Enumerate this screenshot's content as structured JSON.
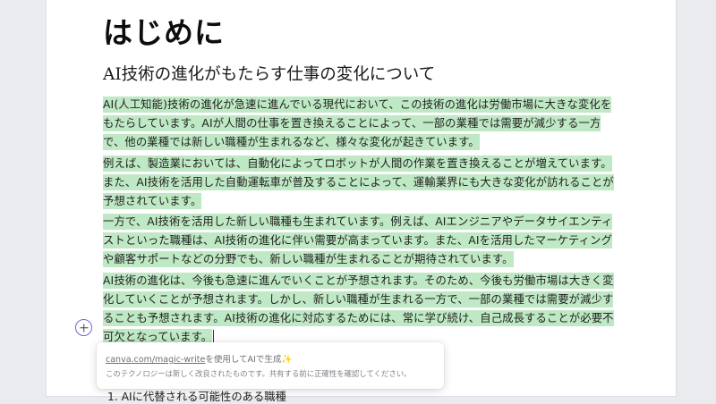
{
  "document": {
    "title": "はじめに",
    "subtitle": "AI技術の進化がもたらす仕事の変化について",
    "paragraphs": [
      "AI(人工知能)技術の進化が急速に進んでいる現代において、この技術の進化は労働市場に大きな変化をもたらしています。AIが人間の仕事を置き換えることによって、一部の業種では需要が減少する一方で、他の業種では新しい職種が生まれるなど、様々な変化が起きています。",
      "例えば、製造業においては、自動化によってロボットが人間の作業を置き換えることが増えています。また、AI技術を活用した自動運転車が普及することによって、運輸業界にも大きな変化が訪れることが予想されています。",
      "一方で、AI技術を活用した新しい職種も生まれています。例えば、AIエンジニアやデータサイエンティストといった職種は、AI技術の進化に伴い需要が高まっています。また、AIを活用したマーケティングや顧客サポートなどの分野でも、新しい職種が生まれることが期待されています。",
      "AI技術の進化は、今後も急速に進んでいくことが予想されます。そのため、今後も労働市場は大きく変化していくことが予想されます。しかし、新しい職種が生まれる一方で、一部の業種では需要が減少することも予想されます。AI技術の進化に対応するためには、常に学び続け、自己成長することが必要不可欠となっています。"
    ],
    "list_item_peek": "1. AIに代替される可能性のある職種"
  },
  "magic_write_notice": {
    "link_text": "canva.com/magic-write",
    "suffix_text": "を使用してAIで生成",
    "sparkle_icon": "sparkle-icon",
    "disclaimer": "このテクノロジーは新しく改良されたものです。共有する前に正確性を確認してください。"
  },
  "colors": {
    "highlight": "#bfe8c4",
    "add_button_border": "#7b61d9",
    "sparkle": "#f2b633"
  }
}
